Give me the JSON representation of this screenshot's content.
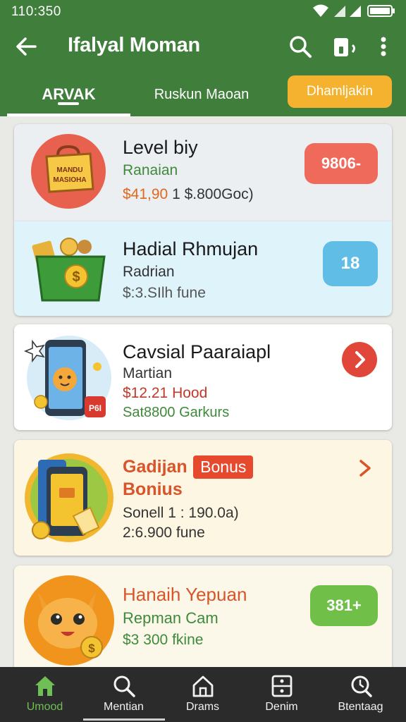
{
  "status_bar": {
    "time": "110:350"
  },
  "app_bar": {
    "title": "Ifalyal Moman",
    "icons": [
      "back-arrow-icon",
      "search-icon",
      "wallet-icon",
      "more-vert-icon"
    ]
  },
  "tabs": [
    {
      "label": "ARVAK",
      "active": true
    },
    {
      "label": "Ruskun Maoan",
      "active": false
    },
    {
      "label": "Dhamljakin",
      "active": false,
      "highlight": true
    }
  ],
  "cards": [
    {
      "title": "Level biy",
      "subtitle": "Ranaian",
      "amount": "$41,90",
      "amount_extra": " 1 $.800Goc)",
      "badge": "9806-",
      "illustration_text": "MANDU\nMASIOHA",
      "icon": "red-bag-icon"
    },
    {
      "title": "Hadial Rhmujan",
      "subtitle": "Radrian",
      "detail": "$:3.SIlh fune",
      "badge": "18",
      "icon": "money-box-icon"
    },
    {
      "title": "Cavsial Paaraiapl",
      "subtitle": "Martian",
      "amount": "$12.21 Hood",
      "detail": "Sat8800 Garkurs",
      "icon": "phone-mascot-icon",
      "cup_text": "P6I"
    },
    {
      "title": "Gadijan",
      "badge_inline": "Bonus",
      "subtitle": "Bonius",
      "line1": "Sonell 1 : 190.0a)",
      "line2": "2:6.900 fune",
      "icon": "phone-bonus-icon"
    },
    {
      "title": "Hanaih Yepuan",
      "subtitle": "Repman Cam",
      "detail": "$3 300 fkine",
      "badge": "381+",
      "icon": "cat-coin-icon"
    }
  ],
  "bottom_nav": [
    {
      "label": "Umood",
      "icon": "home-icon",
      "active": true
    },
    {
      "label": "Mentian",
      "icon": "search-icon",
      "active": false
    },
    {
      "label": "Drams",
      "icon": "house-outline-icon",
      "active": false
    },
    {
      "label": "Denim",
      "icon": "wallet-icon",
      "active": false
    },
    {
      "label": "Btentaag",
      "icon": "history-icon",
      "active": false
    }
  ],
  "colors": {
    "header_green": "#3f7e3b",
    "tab_highlight": "#f5b22e",
    "green_text": "#3e8a3a",
    "orange_text": "#e0681e",
    "red_text": "#c0392b",
    "badge_red": "#ef6a5a",
    "badge_blue": "#5fbde6",
    "badge_green": "#6fbf49",
    "chevron_red": "#e0473a",
    "nav_active": "#6fbf56"
  }
}
